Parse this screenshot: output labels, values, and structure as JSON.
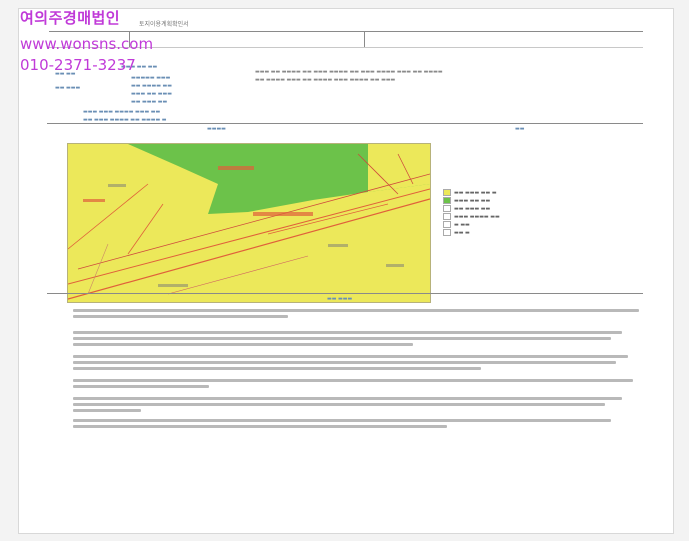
{
  "watermark": {
    "company": "여의주경매법인",
    "website": "www.wonsns.com",
    "phone": "010-2371-3237"
  },
  "document": {
    "title": "토지이용계획확인서"
  },
  "colors": {
    "map_zone_yellow": "#ece85a",
    "map_zone_green": "#6cc24a",
    "map_parcel_line": "#e0603a",
    "watermark": "#c03ad8"
  }
}
